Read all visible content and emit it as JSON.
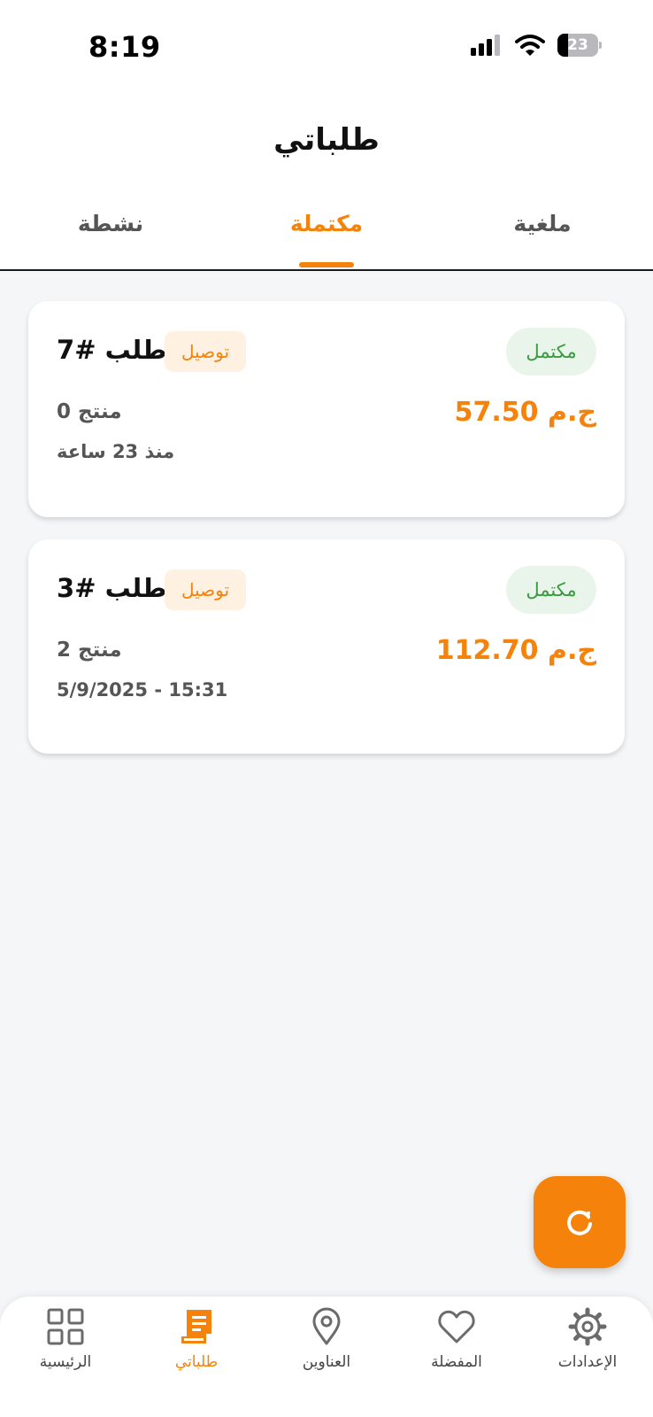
{
  "status_bar": {
    "time": "8:19",
    "battery": "23"
  },
  "header": {
    "title": "طلباتي"
  },
  "tabs": [
    {
      "label": "ملغية",
      "active": false
    },
    {
      "label": "مكتملة",
      "active": true
    },
    {
      "label": "نشطة",
      "active": false
    }
  ],
  "orders": [
    {
      "title": "طلب #7",
      "type": "توصيل",
      "status": "مكتمل",
      "price": "ج.م 57.50",
      "count": "منتج 0",
      "time": "منذ 23 ساعة"
    },
    {
      "title": "طلب #3",
      "type": "توصيل",
      "status": "مكتمل",
      "price": "ج.م 112.70",
      "count": "منتج 2",
      "time": "5/9/2025 - 15:31"
    }
  ],
  "fab": {
    "icon": "refresh-icon"
  },
  "bottom_nav": [
    {
      "label": "الرئيسية",
      "icon": "grid-icon",
      "active": false
    },
    {
      "label": "طلباتي",
      "icon": "receipt-icon",
      "active": true
    },
    {
      "label": "العناوين",
      "icon": "location-pin-icon",
      "active": false
    },
    {
      "label": "المفضلة",
      "icon": "heart-icon",
      "active": false
    },
    {
      "label": "الإعدادات",
      "icon": "gear-icon",
      "active": false
    }
  ],
  "colors": {
    "accent": "#f5820a",
    "success": "#3a9a3e",
    "success_bg": "#e9f5ea",
    "accent_bg": "#fff1e2",
    "background": "#f5f6f8"
  }
}
